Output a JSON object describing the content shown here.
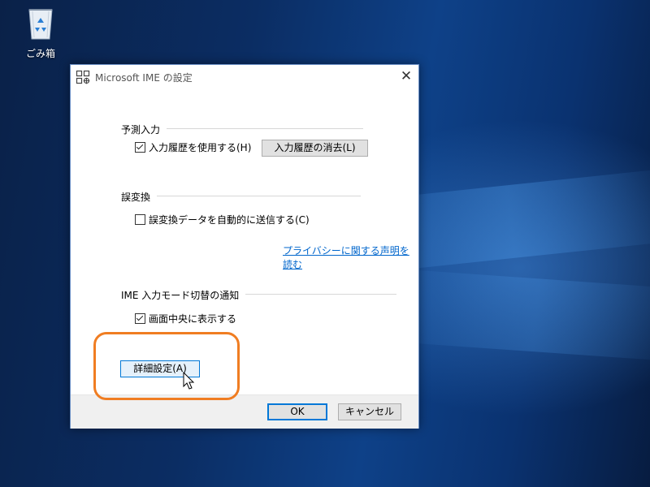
{
  "desktop": {
    "recycle_bin_label": "ごみ箱",
    "recycle_bin_icon": "recycle-bin-icon"
  },
  "dialog": {
    "title": "Microsoft IME の設定",
    "title_icon": "ime-settings-icon",
    "close_glyph": "✕",
    "sections": {
      "prediction": {
        "title": "予測入力",
        "use_history_label": "入力履歴を使用する(H)",
        "use_history_checked": true,
        "clear_history_button": "入力履歴の消去(L)"
      },
      "misconversion": {
        "title": "誤変換",
        "send_data_label": "誤変換データを自動的に送信する(C)",
        "send_data_checked": false,
        "privacy_link": "プライバシーに関する声明を読む"
      },
      "mode_notification": {
        "title": "IME 入力モード切替の通知",
        "show_center_label": "画面中央に表示する",
        "show_center_checked": true
      }
    },
    "advanced_button": "詳細設定(A)",
    "ok_button": "OK",
    "cancel_button": "キャンセル"
  },
  "annotation": {
    "highlight_color": "#f07d22"
  },
  "colors": {
    "accent": "#0078d7",
    "link": "#0066cc"
  }
}
